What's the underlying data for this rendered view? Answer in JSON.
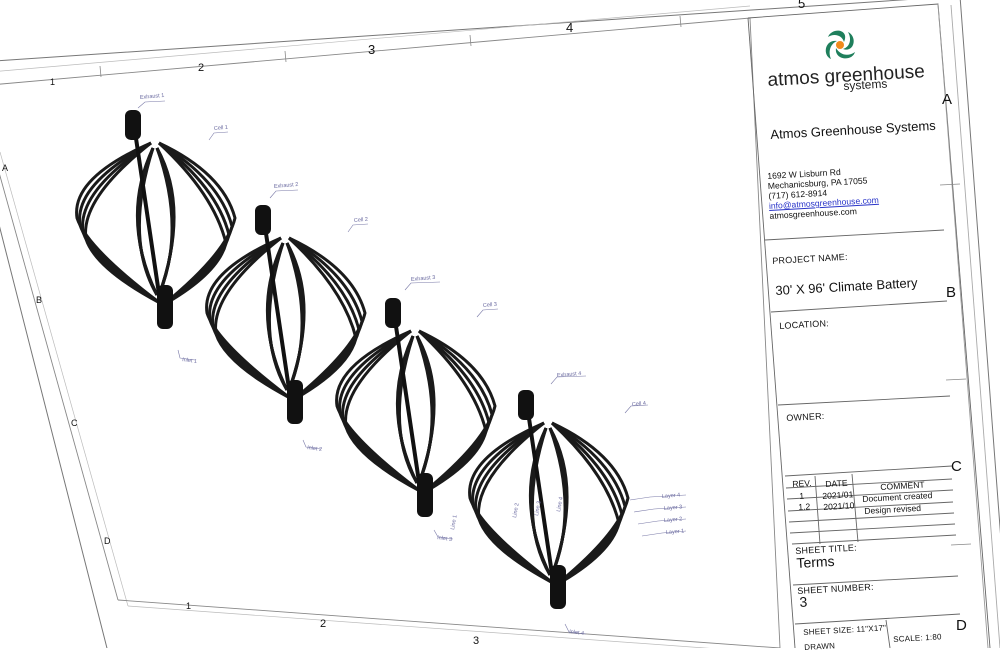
{
  "company": {
    "logo_word": "atmos greenhouse",
    "logo_sub": "systems",
    "name": "Atmos Greenhouse Systems",
    "address_line1": "1692 W Lisburn Rd",
    "address_line2": "Mechanicsburg, PA 17055",
    "phone": "(717) 612-8914",
    "email": "info@atmosgreenhouse.com",
    "website": "atmosgreenhouse.com",
    "logo_colors": [
      "#1f7f5c",
      "#f08a1c"
    ]
  },
  "title_block": {
    "project_name_label": "PROJECT NAME:",
    "project_name": "30' X 96' Climate Battery",
    "location_label": "LOCATION:",
    "owner_label": "OWNER:",
    "revision_headers": {
      "rev": "REV.",
      "date": "DATE",
      "comment": "COMMENT"
    },
    "revisions": [
      {
        "rev": "1",
        "date": "2021/01",
        "comment": "Document created"
      },
      {
        "rev": "1.2",
        "date": "2021/10",
        "comment": "Design revised"
      }
    ],
    "sheet_title_label": "SHEET TITLE:",
    "sheet_title": "Terms",
    "sheet_number_label": "SHEET NUMBER:",
    "sheet_number": "3",
    "sheet_size": "SHEET SIZE: 11\"X17\"",
    "scale": "SCALE: 1:80",
    "drawn_partial": "DRAWN"
  },
  "border_labels": {
    "top": [
      "1",
      "2",
      "3",
      "4",
      "5"
    ],
    "right": [
      "A",
      "B",
      "C",
      "D"
    ],
    "left": [
      "A",
      "B",
      "C",
      "D"
    ],
    "bottom": [
      "1",
      "2",
      "3"
    ]
  },
  "annotations": {
    "exhaust": [
      "Exhaust 1",
      "Exhaust 2",
      "Exhaust 3",
      "Exhaust 4"
    ],
    "cell": [
      "Cell 1",
      "Cell 2",
      "Cell 3",
      "Cell 4"
    ],
    "inlet": [
      "Inlet 1",
      "Inlet 2",
      "Inlet 3",
      "Inlet 4"
    ],
    "layers": [
      "Layer 4",
      "Layer 3",
      "Layer 2",
      "Layer 1"
    ],
    "lines": [
      "Line 1",
      "Line 2",
      "Line 3",
      "Line 4"
    ]
  }
}
